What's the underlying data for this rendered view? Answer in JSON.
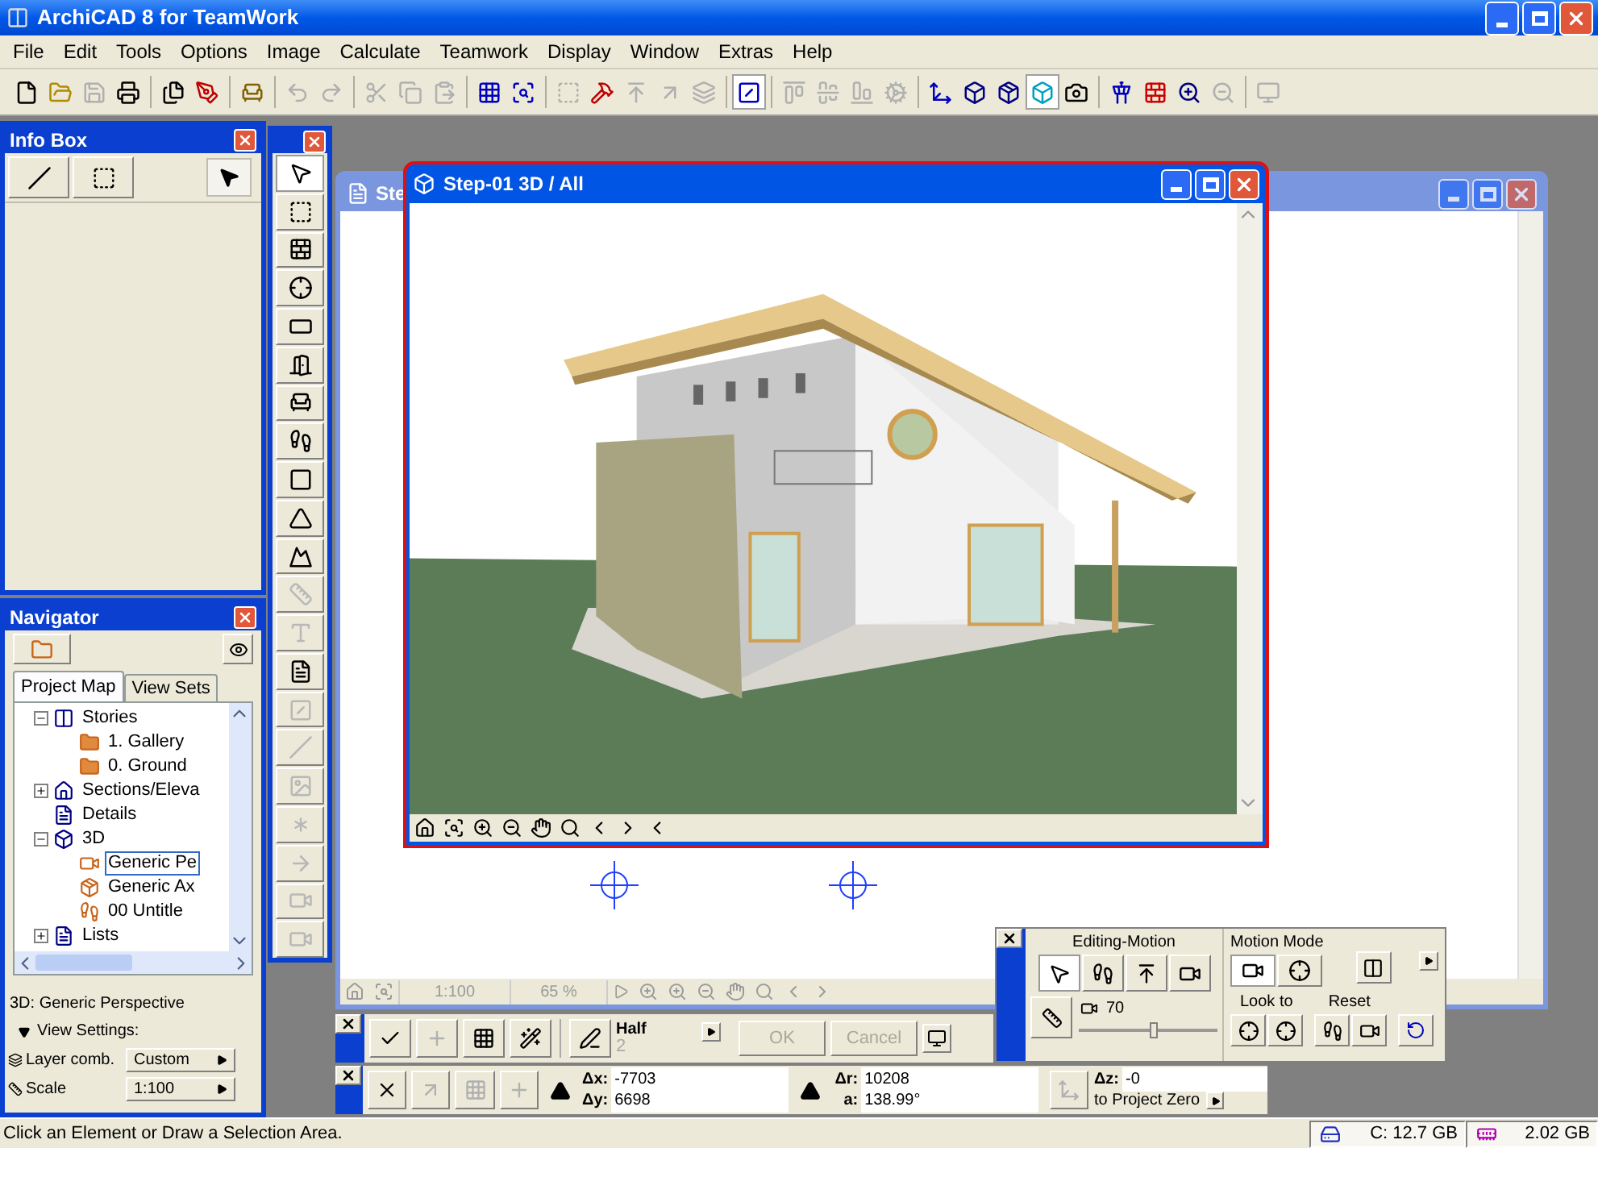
{
  "window": {
    "title": "ArchiCAD 8 for TeamWork"
  },
  "menu": [
    "File",
    "Edit",
    "Tools",
    "Options",
    "Image",
    "Calculate",
    "Teamwork",
    "Display",
    "Window",
    "Extras",
    "Help"
  ],
  "toolbar": [
    {
      "selected": false,
      "disabled": false
    },
    {
      "selected": false,
      "disabled": false
    },
    {
      "selected": false,
      "disabled": true
    },
    {
      "selected": false,
      "disabled": false
    },
    {
      "selected": false,
      "disabled": false
    },
    {
      "selected": false,
      "disabled": false
    },
    {
      "selected": false,
      "disabled": false
    },
    {
      "selected": false,
      "disabled": true
    },
    {
      "selected": false,
      "disabled": true
    },
    {
      "selected": false,
      "disabled": true
    },
    {
      "selected": false,
      "disabled": true
    },
    {
      "selected": false,
      "disabled": true
    },
    {
      "selected": false,
      "disabled": false
    },
    {
      "selected": false,
      "disabled": false
    },
    {
      "selected": false,
      "disabled": true
    },
    {
      "selected": false,
      "disabled": false
    },
    {
      "selected": false,
      "disabled": true
    },
    {
      "selected": false,
      "disabled": true
    },
    {
      "selected": false,
      "disabled": true
    },
    {
      "selected": true,
      "disabled": false
    },
    {
      "selected": false,
      "disabled": true
    },
    {
      "selected": false,
      "disabled": true
    },
    {
      "selected": false,
      "disabled": true
    },
    {
      "selected": false,
      "disabled": true
    },
    {
      "selected": false,
      "disabled": false
    },
    {
      "selected": false,
      "disabled": false
    },
    {
      "selected": false,
      "disabled": false
    },
    {
      "selected": true,
      "disabled": false
    },
    {
      "selected": false,
      "disabled": false
    },
    {
      "selected": false,
      "disabled": false
    },
    {
      "selected": false,
      "disabled": false
    },
    {
      "selected": false,
      "disabled": false
    },
    {
      "selected": false,
      "disabled": true
    },
    {
      "selected": false,
      "disabled": true
    }
  ],
  "info_box": {
    "title": "Info Box"
  },
  "toolbox": [
    {
      "selected": true,
      "disabled": false
    },
    {
      "selected": false,
      "disabled": false
    },
    {
      "selected": false,
      "disabled": false
    },
    {
      "selected": false,
      "disabled": false
    },
    {
      "selected": false,
      "disabled": false
    },
    {
      "selected": false,
      "disabled": false
    },
    {
      "selected": false,
      "disabled": false
    },
    {
      "selected": false,
      "disabled": false
    },
    {
      "selected": false,
      "disabled": false
    },
    {
      "selected": false,
      "disabled": false
    },
    {
      "selected": false,
      "disabled": false
    },
    {
      "selected": false,
      "disabled": true
    },
    {
      "selected": false,
      "disabled": true
    },
    {
      "selected": false,
      "disabled": false
    },
    {
      "selected": false,
      "disabled": true
    },
    {
      "selected": false,
      "disabled": true
    },
    {
      "selected": false,
      "disabled": true
    },
    {
      "selected": false,
      "disabled": true
    },
    {
      "selected": false,
      "disabled": true
    },
    {
      "selected": false,
      "disabled": true
    },
    {
      "selected": false,
      "disabled": true
    }
  ],
  "navigator": {
    "title": "Navigator",
    "tabs": [
      {
        "label": "Project Map",
        "selected": true
      },
      {
        "label": "View Sets",
        "selected": false
      }
    ],
    "tree": [
      {
        "label": "Stories",
        "kind": "stories",
        "selected": false,
        "expanded": true,
        "children": [
          {
            "label": "1. Gallery",
            "kind": "story",
            "selected": false
          },
          {
            "label": "0. Ground",
            "kind": "story",
            "selected": false
          }
        ]
      },
      {
        "label": "Sections/Eleva",
        "kind": "sections",
        "selected": false,
        "expanded": false
      },
      {
        "label": "Details",
        "kind": "details",
        "selected": false
      },
      {
        "label": "3D",
        "kind": "view3d",
        "selected": false,
        "expanded": true,
        "children": [
          {
            "label": "Generic Pe",
            "kind": "camera",
            "selected": true
          },
          {
            "label": "Generic Ax",
            "kind": "axon",
            "selected": false
          },
          {
            "label": "00 Untitle",
            "kind": "walk",
            "selected": false
          }
        ]
      },
      {
        "label": "Lists",
        "kind": "lists",
        "selected": false,
        "expanded": false
      }
    ],
    "current_view": "3D: Generic Perspective",
    "view_settings": "View Settings:",
    "settings": [
      {
        "kind": "layers",
        "label": "Layer comb.",
        "value": "Custom"
      },
      {
        "kind": "scale",
        "label": "Scale",
        "value": "1:100"
      }
    ]
  },
  "background_window": {
    "title": "Ste",
    "scale": "1:100",
    "zoom": "65 %"
  },
  "view_window": {
    "title": "Step-01 3D / All"
  },
  "control_box": {
    "pen_label": "Half",
    "pen_number": "2",
    "buttons": [
      {
        "label": "OK",
        "disabled": true
      },
      {
        "label": "Cancel",
        "disabled": true
      }
    ]
  },
  "coordinates": {
    "groups": [
      [
        {
          "label": "Δx:",
          "value": "-7703"
        },
        {
          "label": "Δy:",
          "value": "6698"
        }
      ],
      [
        {
          "label": "Δr:",
          "value": "10208"
        },
        {
          "label": "a:",
          "value": "138.99°"
        }
      ]
    ],
    "z": {
      "label": "Δz:",
      "value": "-0"
    },
    "reference": "to Project Zero"
  },
  "nav_palette": {
    "editing_title": "Editing-Motion",
    "motion_title": "Motion Mode",
    "look_to": "Look to",
    "reset": "Reset",
    "modes": [
      {
        "selected": true
      },
      {
        "selected": false
      }
    ],
    "slider": {
      "level": 0.55,
      "reading": "70"
    }
  },
  "status_bar": {
    "message": "Click an Element or Draw a Selection Area.",
    "disk": "C: 12.7 GB",
    "memory": "2.02 GB"
  }
}
